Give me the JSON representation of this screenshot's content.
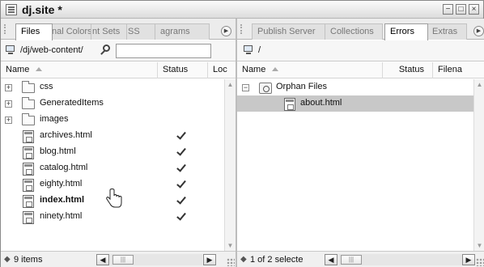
{
  "window": {
    "title": "dj.site *",
    "buttons": [
      "−",
      "□",
      "×"
    ]
  },
  "left_panel": {
    "tabs": [
      {
        "label": "Files",
        "active": true
      },
      {
        "label": "nal Colors",
        "active": false
      },
      {
        "label": "nt Sets",
        "active": false
      },
      {
        "label": "SS",
        "active": false
      },
      {
        "label": "agrams",
        "active": false
      }
    ],
    "path": "/dj/web-content/",
    "search": {
      "value": "",
      "placeholder": ""
    },
    "columns": [
      "Name",
      "Status",
      "Loc"
    ],
    "items": [
      {
        "name": "css",
        "type": "folder",
        "status": "",
        "bold": false
      },
      {
        "name": "GeneratedItems",
        "type": "folder",
        "status": "",
        "bold": false
      },
      {
        "name": "images",
        "type": "folder",
        "status": "",
        "bold": false
      },
      {
        "name": "archives.html",
        "type": "file",
        "status": "✔",
        "bold": false
      },
      {
        "name": "blog.html",
        "type": "file",
        "status": "✔",
        "bold": false
      },
      {
        "name": "catalog.html",
        "type": "file",
        "status": "✔",
        "bold": false
      },
      {
        "name": "eighty.html",
        "type": "file",
        "status": "✔",
        "bold": false
      },
      {
        "name": "index.html",
        "type": "file",
        "status": "✔",
        "bold": true
      },
      {
        "name": "ninety.html",
        "type": "file",
        "status": "✔",
        "bold": false
      }
    ],
    "status_text": "9 items"
  },
  "right_panel": {
    "tabs": [
      {
        "label": "Publish Server",
        "active": false
      },
      {
        "label": "Collections",
        "active": false
      },
      {
        "label": "Errors",
        "active": true
      },
      {
        "label": "Extras",
        "active": false
      }
    ],
    "path": "/",
    "columns": [
      "Name",
      "Status",
      "Filena"
    ],
    "group": {
      "label": "Orphan Files"
    },
    "items": [
      {
        "name": "about.html",
        "selected": true
      }
    ],
    "status_text": "1 of 2 selecte"
  },
  "icons": {
    "expand": "plus-box-icon",
    "collapse": "minus-box-icon",
    "status_symbol": "◆"
  },
  "colors": {
    "selection": "#c8c8c8",
    "panel_bg": "#ffffff",
    "chrome_bg": "#ececec"
  }
}
